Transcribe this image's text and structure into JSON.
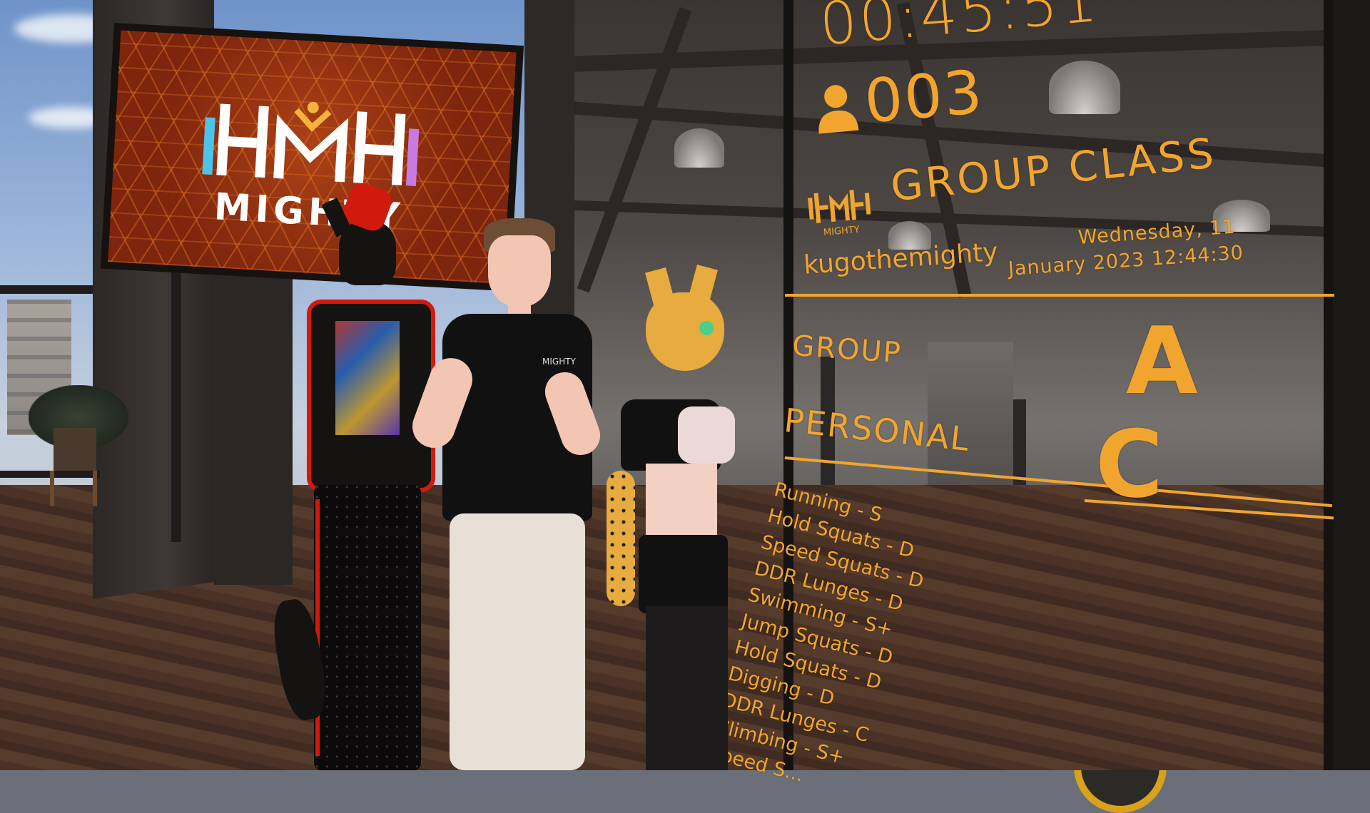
{
  "tv": {
    "brand": "MIGHTY"
  },
  "overlay": {
    "timer": "00:45:51",
    "player_count": "003",
    "class_title": "GROUP CLASS",
    "logo_text": "MIGHTY",
    "username": "kugothemighty",
    "date_line1": "Wednesday, 11",
    "date_line2": "January 2023 12:44:30",
    "group_label": "GROUP",
    "group_grade": "A",
    "personal_label": "PERSONAL",
    "personal_grade": "C",
    "activities": [
      "Running - S",
      "Hold Squats - D",
      "Speed Squats - D",
      "DDR Lunges - D",
      "Swimming - S+",
      "Jump Squats - D",
      "Hold Squats - D",
      "Digging - D",
      "DDR Lunges - C",
      "Climbing - S+",
      "Speed S..."
    ]
  },
  "shirt_logo": "MIGHTY",
  "colors": {
    "overlay_accent": "#f2a52e",
    "tv_background": "#7e250d",
    "red_avatar": "#d11a0e"
  },
  "icons": {
    "person": "person-icon",
    "logo": "mighty-logo-icon"
  }
}
